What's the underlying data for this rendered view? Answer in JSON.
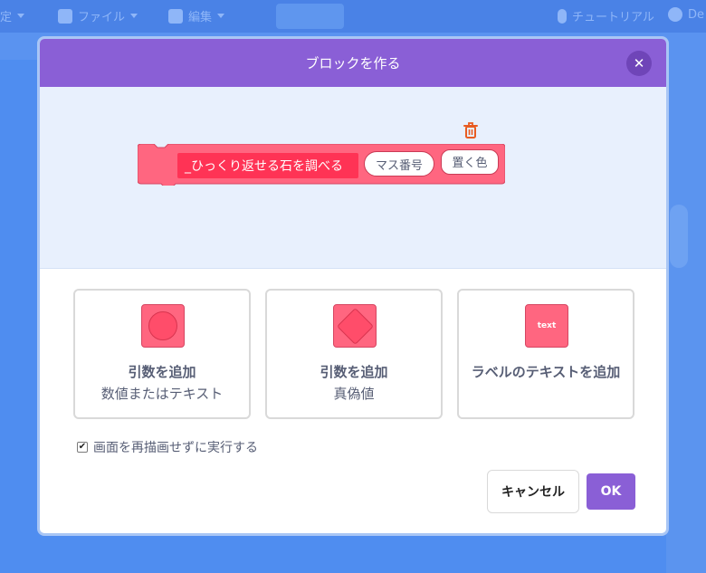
{
  "background_menubar": {
    "items": [
      {
        "label": "定",
        "icon": "settings-icon"
      },
      {
        "label": "ファイル",
        "icon": "file-icon"
      },
      {
        "label": "編集",
        "icon": "edit-icon"
      },
      {
        "label": "チュートリアル",
        "icon": "tutorial-icon"
      },
      {
        "label": "De",
        "icon": "debug-icon"
      }
    ]
  },
  "dialog": {
    "title": "ブロックを作る",
    "close_icon": "close-icon",
    "block": {
      "label": "_ひっくり返せる石を調べる",
      "arguments": [
        "マス番号",
        "置く色"
      ],
      "color": "#ff6680"
    },
    "options": [
      {
        "title": "引数を追加",
        "subtitle": "数値またはテキスト",
        "icon": "number-text-input-icon"
      },
      {
        "title": "引数を追加",
        "subtitle": "真偽値",
        "icon": "boolean-input-icon"
      },
      {
        "title": "ラベルのテキストを追加",
        "subtitle": "",
        "icon": "label-text-icon",
        "icon_text": "text"
      }
    ],
    "run_without_refresh": {
      "label": "画面を再描画せずに実行する",
      "checked": true
    },
    "cancel_label": "キャンセル",
    "ok_label": "OK"
  },
  "colors": {
    "header": "#8a5fd6",
    "preview_bg": "#e8f0fd",
    "block": "#ff6680",
    "trash": "#e85c22"
  }
}
